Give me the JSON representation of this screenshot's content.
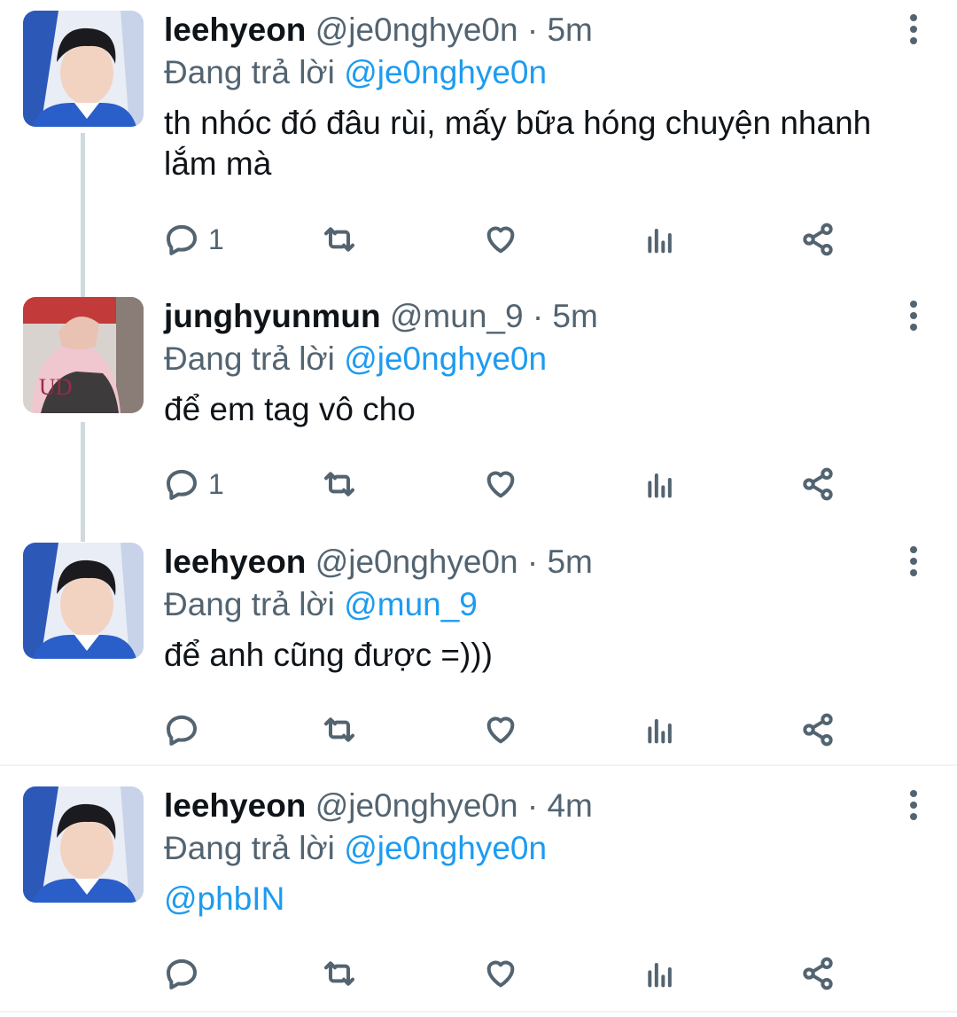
{
  "reply_prefix": "Đang trả lời",
  "tweets": [
    {
      "name": "leehyeon",
      "meta": "@je0nghye0n · 5m",
      "replying_to": "@je0nghye0n",
      "text": "th nhóc đó đâu rùi, mấy bữa hóng chuyện nhanh lắm mà",
      "reply_count": "1"
    },
    {
      "name": "junghyunmun",
      "meta": "@mun_9 · 5m",
      "replying_to": "@je0nghye0n",
      "text": "để em tag vô cho",
      "reply_count": "1"
    },
    {
      "name": "leehyeon",
      "meta": "@je0nghye0n · 5m",
      "replying_to": "@mun_9",
      "text": "để anh cũng được =)))",
      "reply_count": ""
    },
    {
      "name": "leehyeon",
      "meta": "@je0nghye0n · 4m",
      "replying_to": "@je0nghye0n",
      "text": "@phbIN",
      "reply_count": ""
    }
  ],
  "colors": {
    "link": "#1d9bf0",
    "secondary": "#536471",
    "thread_line": "#cfd9de"
  }
}
